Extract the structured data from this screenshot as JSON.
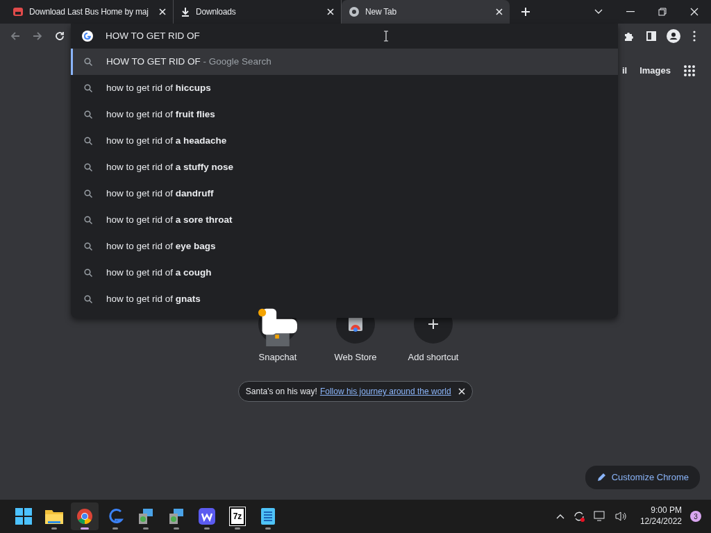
{
  "tabs": [
    {
      "title": "Download Last Bus Home by maj",
      "selected": false
    },
    {
      "title": "Downloads",
      "selected": false
    },
    {
      "title": "New Tab",
      "selected": true
    }
  ],
  "omnibox": {
    "value": "HOW TO GET RID OF"
  },
  "suggestions": [
    {
      "text": "HOW TO GET RID OF",
      "hint": "- Google Search",
      "selected": true
    },
    {
      "text": "how to get rid of **hiccups**",
      "selected": false
    },
    {
      "text": "how to get rid of **fruit flies**",
      "selected": false
    },
    {
      "text": "how to get rid of **a headache**",
      "selected": false
    },
    {
      "text": "how to get rid of **a stuffy nose**",
      "selected": false
    },
    {
      "text": "how to get rid of **dandruff**",
      "selected": false
    },
    {
      "text": "how to get rid of **a sore throat**",
      "selected": false
    },
    {
      "text": "how to get rid of **eye bags**",
      "selected": false
    },
    {
      "text": "how to get rid of **a cough**",
      "selected": false
    },
    {
      "text": "how to get rid of **gnats**",
      "selected": false
    }
  ],
  "header_links": [
    "il",
    "Images"
  ],
  "shortcuts": [
    {
      "label": "Snapchat",
      "kind": "duck"
    },
    {
      "label": "Web Store",
      "kind": "store"
    },
    {
      "label": "Add shortcut",
      "kind": "add"
    }
  ],
  "promo": {
    "text": "Santa's on his way!",
    "link": "Follow his journey around the world"
  },
  "customize_button": "Customize Chrome",
  "taskbar": {
    "apps": [
      {
        "kind": "start",
        "selected": false
      },
      {
        "kind": "folder",
        "selected": false
      },
      {
        "kind": "chrome",
        "selected": true
      },
      {
        "kind": "swirl",
        "selected": false
      },
      {
        "kind": "installer",
        "selected": false
      },
      {
        "kind": "installer",
        "selected": false
      },
      {
        "kind": "w",
        "selected": false
      },
      {
        "kind": "sevenzip",
        "label": "7z",
        "selected": false
      },
      {
        "kind": "notepad",
        "selected": false
      }
    ],
    "time": "9:00 PM",
    "date": "12/24/2022",
    "notifications": "3"
  }
}
